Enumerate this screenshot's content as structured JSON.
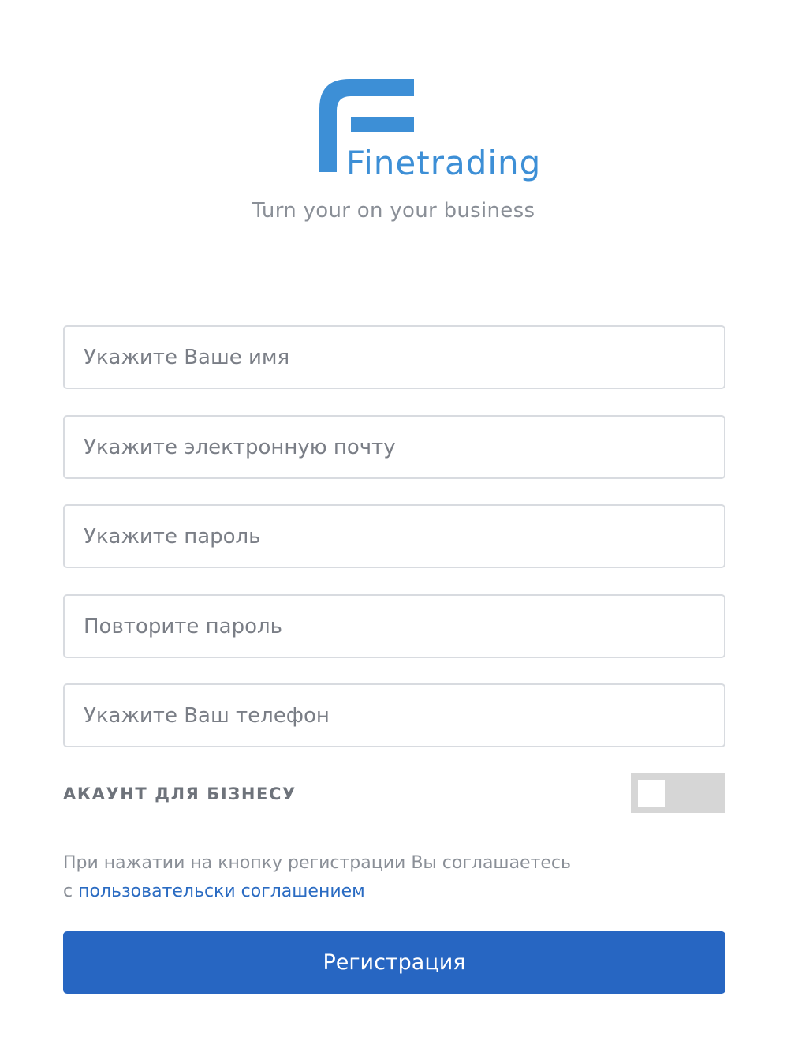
{
  "brand": {
    "logo_text": "Finetrading",
    "tagline": "Turn your on your business",
    "color": "#3d8fd6"
  },
  "form": {
    "fields": [
      {
        "placeholder": "Укажите Ваше имя",
        "value": ""
      },
      {
        "placeholder": "Укажите электронную почту",
        "value": ""
      },
      {
        "placeholder": "Укажите пароль",
        "value": ""
      },
      {
        "placeholder": "Повторите пароль",
        "value": ""
      },
      {
        "placeholder": "Укажите Ваш телефон",
        "value": ""
      }
    ],
    "business_toggle": {
      "label": "АКАУНТ ДЛЯ БІЗНЕСУ",
      "on": false
    },
    "agreement": {
      "text_line1": "При нажатии на кнопку регистрации Вы соглашаетесь",
      "text_prefix": "с ",
      "link_text": "пользовательски соглашением"
    },
    "submit_label": "Регистрация"
  },
  "colors": {
    "primary": "#2766c2",
    "link": "#2a6bc2",
    "toggle_off": "#d6d6d6"
  }
}
